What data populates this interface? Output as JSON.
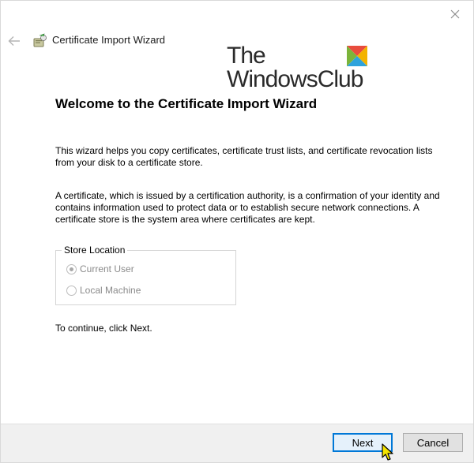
{
  "window": {
    "title": "Certificate Import Wizard",
    "close_icon": "close-icon",
    "back_icon": "back-arrow-icon"
  },
  "watermark": {
    "line1": "The",
    "line2": "WindowsClub",
    "logo_colors": [
      "#e84c3d",
      "#f3b300",
      "#2ea3dc",
      "#7bb43a"
    ]
  },
  "content": {
    "heading": "Welcome to the Certificate Import Wizard",
    "paragraph1": "This wizard helps you copy certificates, certificate trust lists, and certificate revocation lists from your disk to a certificate store.",
    "paragraph2": "A certificate, which is issued by a certification authority, is a confirmation of your identity and contains information used to protect data or to establish secure network connections. A certificate store is the system area where certificates are kept.",
    "continue_hint": "To continue, click Next."
  },
  "store_location": {
    "legend": "Store Location",
    "options": [
      {
        "label": "Current User",
        "selected": true,
        "enabled": false
      },
      {
        "label": "Local Machine",
        "selected": false,
        "enabled": false
      }
    ]
  },
  "footer": {
    "next_label": "Next",
    "cancel_label": "Cancel",
    "accent_color": "#0078d7"
  }
}
